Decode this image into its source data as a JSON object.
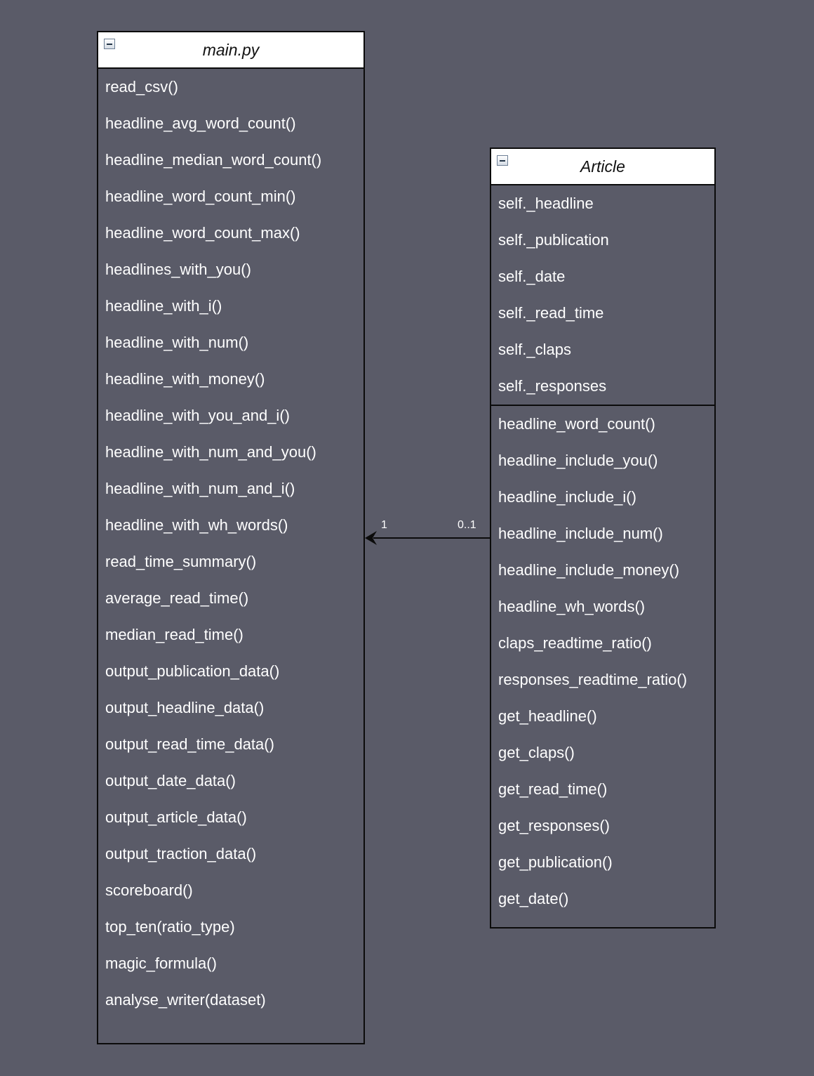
{
  "main_class": {
    "title": "main.py",
    "methods": [
      "read_csv()",
      "headline_avg_word_count()",
      "headline_median_word_count()",
      "headline_word_count_min()",
      "headline_word_count_max()",
      "headlines_with_you()",
      "headline_with_i()",
      "headline_with_num()",
      "headline_with_money()",
      "headline_with_you_and_i()",
      "headline_with_num_and_you()",
      "headline_with_num_and_i()",
      "headline_with_wh_words()",
      "read_time_summary()",
      "average_read_time()",
      "median_read_time()",
      "output_publication_data()",
      "output_headline_data()",
      "output_read_time_data()",
      "output_date_data()",
      "output_article_data()",
      "output_traction_data()",
      "scoreboard()",
      "top_ten(ratio_type)",
      "magic_formula()",
      "analyse_writer(dataset)"
    ]
  },
  "article_class": {
    "title": "Article",
    "attributes": [
      "self._headline",
      "self._publication",
      "self._date",
      "self._read_time",
      "self._claps",
      "self._responses"
    ],
    "methods": [
      "headline_word_count()",
      "headline_include_you()",
      "headline_include_i()",
      "headline_include_num()",
      "headline_include_money()",
      "headline_wh_words()",
      "claps_readtime_ratio()",
      "responses_readtime_ratio()",
      "get_headline()",
      "get_claps()",
      "get_read_time()",
      "get_responses()",
      "get_publication()",
      "get_date()"
    ]
  },
  "association": {
    "target_multiplicity": "1",
    "source_multiplicity": "0..1"
  },
  "colors": {
    "canvas": "#5a5b68",
    "header": "#ffffff",
    "border": "#0b0b0b",
    "text": "#ffffff"
  }
}
